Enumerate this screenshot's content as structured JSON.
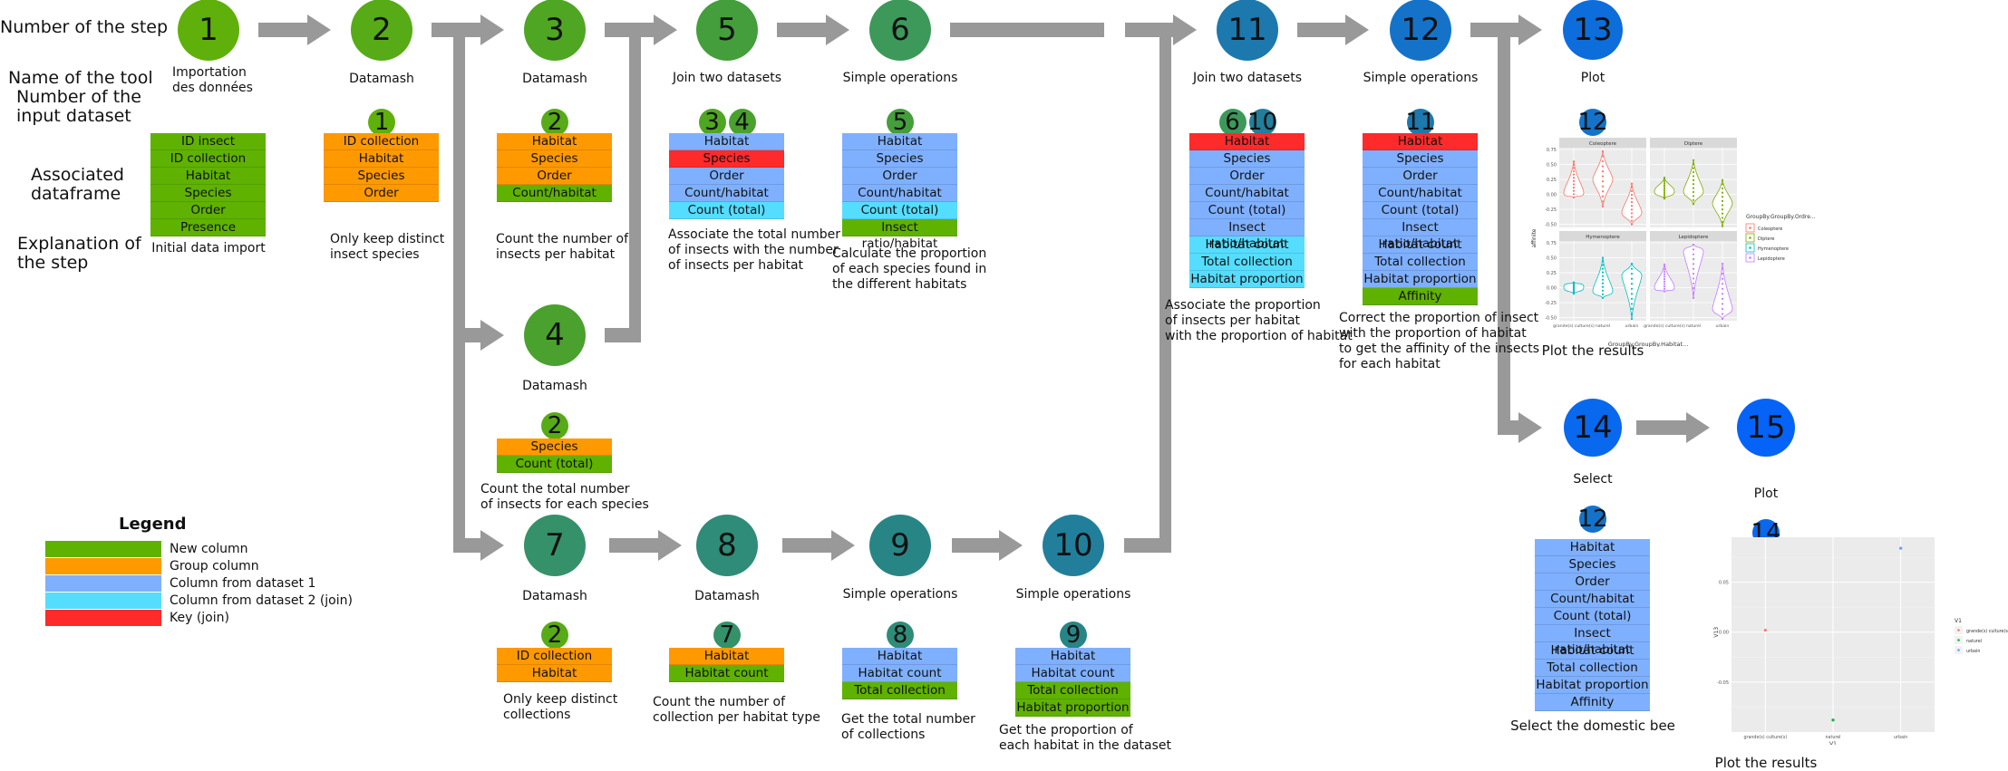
{
  "row_labels": {
    "step_number": "Number of the step",
    "tool_name": "Name of the tool",
    "input_dataset": "Number of the\ninput dataset",
    "dataframe": "Associated\ndataframe",
    "explanation": "Explanation of\nthe step"
  },
  "colors": {
    "new_column": "#5fb200",
    "group_column": "#ff9900",
    "dataset1": "#7fb0ff",
    "dataset2": "#55ddff",
    "key": "#ff2a2a",
    "arrow": "#999999"
  },
  "legend": {
    "title": "Legend",
    "items": [
      {
        "label": "New column",
        "type": "new_column"
      },
      {
        "label": "Group column",
        "type": "group_column"
      },
      {
        "label": "Column from dataset 1",
        "type": "dataset1"
      },
      {
        "label": "Column from dataset 2 (join)",
        "type": "dataset2"
      },
      {
        "label": "Key (join)",
        "type": "key"
      }
    ]
  },
  "steps": [
    {
      "id": "1",
      "color": "#5fb00a",
      "tool": "Importation\ndes données",
      "inputs": [],
      "columns": [
        [
          "ID insect",
          "new_column"
        ],
        [
          "ID collection",
          "new_column"
        ],
        [
          "Habitat",
          "new_column"
        ],
        [
          "Species",
          "new_column"
        ],
        [
          "Order",
          "new_column"
        ],
        [
          "Presence",
          "new_column"
        ]
      ],
      "explanation": "Initial data import"
    },
    {
      "id": "2",
      "color": "#57ab16",
      "tool": "Datamash",
      "inputs": [
        {
          "id": "1",
          "color": "#5fb00a"
        }
      ],
      "columns": [
        [
          "ID collection",
          "group_column"
        ],
        [
          "Habitat",
          "group_column"
        ],
        [
          "Species",
          "group_column"
        ],
        [
          "Order",
          "group_column"
        ]
      ],
      "explanation": "Only keep distinct\ninsect species"
    },
    {
      "id": "3",
      "color": "#4fa623",
      "tool": "Datamash",
      "inputs": [
        {
          "id": "2",
          "color": "#57ab16"
        }
      ],
      "columns": [
        [
          "Habitat",
          "group_column"
        ],
        [
          "Species",
          "group_column"
        ],
        [
          "Order",
          "group_column"
        ],
        [
          "Count/habitat",
          "new_column"
        ]
      ],
      "explanation": "Count the number of\ninsects per habitat"
    },
    {
      "id": "4",
      "color": "#4aa12e",
      "tool": "Datamash",
      "inputs": [
        {
          "id": "2",
          "color": "#57ab16"
        }
      ],
      "columns": [
        [
          "Species",
          "group_column"
        ],
        [
          "Count (total)",
          "new_column"
        ]
      ],
      "explanation": "Count the total number\nof insects for each species"
    },
    {
      "id": "5",
      "color": "#449e3b",
      "tool": "Join two datasets",
      "inputs": [
        {
          "id": "3",
          "color": "#4fa623"
        },
        {
          "id": "4",
          "color": "#4aa12e"
        }
      ],
      "columns": [
        [
          "Habitat",
          "dataset1"
        ],
        [
          "Species",
          "key"
        ],
        [
          "Order",
          "dataset1"
        ],
        [
          "Count/habitat",
          "dataset1"
        ],
        [
          "Count (total)",
          "dataset2"
        ]
      ],
      "explanation": "Associate the total number\nof insects with the number\nof insects per habitat"
    },
    {
      "id": "6",
      "color": "#3c995a",
      "tool": "Simple operations",
      "inputs": [
        {
          "id": "5",
          "color": "#449e3b"
        }
      ],
      "columns": [
        [
          "Habitat",
          "dataset1"
        ],
        [
          "Species",
          "dataset1"
        ],
        [
          "Order",
          "dataset1"
        ],
        [
          "Count/habitat",
          "dataset1"
        ],
        [
          "Count (total)",
          "dataset2"
        ],
        [
          "Insect ratio/habitat",
          "new_column"
        ]
      ],
      "explanation": "Calculate the proportion\nof each species found in\nthe different habitats"
    },
    {
      "id": "7",
      "color": "#349169",
      "tool": "Datamash",
      "inputs": [
        {
          "id": "2",
          "color": "#57ab16"
        }
      ],
      "columns": [
        [
          "ID collection",
          "group_column"
        ],
        [
          "Habitat",
          "group_column"
        ]
      ],
      "explanation": "Only keep distinct\ncollections"
    },
    {
      "id": "8",
      "color": "#2e8c78",
      "tool": "Datamash",
      "inputs": [
        {
          "id": "7",
          "color": "#349169"
        }
      ],
      "columns": [
        [
          "Habitat",
          "group_column"
        ],
        [
          "Habitat count",
          "new_column"
        ]
      ],
      "explanation": "Count the number of\ncollection per habitat type"
    },
    {
      "id": "9",
      "color": "#288586",
      "tool": "Simple operations",
      "inputs": [
        {
          "id": "8",
          "color": "#2e8c78"
        }
      ],
      "columns": [
        [
          "Habitat",
          "dataset1"
        ],
        [
          "Habitat count",
          "dataset1"
        ],
        [
          "Total collection",
          "new_column"
        ]
      ],
      "explanation": "Get the total number\nof collections"
    },
    {
      "id": "10",
      "color": "#217f9c",
      "tool": "Simple operations",
      "inputs": [
        {
          "id": "9",
          "color": "#288586"
        }
      ],
      "columns": [
        [
          "Habitat",
          "dataset1"
        ],
        [
          "Habitat count",
          "dataset1"
        ],
        [
          "Total collection",
          "new_column"
        ],
        [
          "Habitat proportion",
          "new_column"
        ]
      ],
      "explanation": "Get the proportion of\neach habitat in the dataset"
    },
    {
      "id": "11",
      "color": "#1c78ad",
      "tool": "Join two datasets",
      "inputs": [
        {
          "id": "6",
          "color": "#3c995a"
        },
        {
          "id": "10",
          "color": "#217f9c"
        }
      ],
      "columns": [
        [
          "Habitat",
          "key"
        ],
        [
          "Species",
          "dataset1"
        ],
        [
          "Order",
          "dataset1"
        ],
        [
          "Count/habitat",
          "dataset1"
        ],
        [
          "Count (total)",
          "dataset1"
        ],
        [
          "Insect ratio/habitat",
          "dataset1"
        ],
        [
          "Habitat count",
          "dataset2"
        ],
        [
          "Total collection",
          "dataset2"
        ],
        [
          "Habitat proportion",
          "dataset2"
        ]
      ],
      "explanation": "Associate the proportion\nof insects per habitat\nwith the proportion of habitat"
    },
    {
      "id": "12",
      "color": "#1473c9",
      "tool": "Simple operations",
      "inputs": [
        {
          "id": "11",
          "color": "#1c78ad"
        }
      ],
      "columns": [
        [
          "Habitat",
          "key"
        ],
        [
          "Species",
          "dataset1"
        ],
        [
          "Order",
          "dataset1"
        ],
        [
          "Count/habitat",
          "dataset1"
        ],
        [
          "Count (total)",
          "dataset1"
        ],
        [
          "Insect ratio/habitat",
          "dataset1"
        ],
        [
          "Habitat count",
          "dataset1"
        ],
        [
          "Total collection",
          "dataset1"
        ],
        [
          "Habitat proportion",
          "dataset1"
        ],
        [
          "Affinity",
          "new_column"
        ]
      ],
      "explanation": "Correct the proportion of insect\nwith the proportion of habitat\nto get the affinity of the insects\nfor each habitat"
    },
    {
      "id": "13",
      "color": "#0d6ddb",
      "tool": "Plot",
      "inputs": [
        {
          "id": "12",
          "color": "#1473c9"
        }
      ],
      "columns": [],
      "explanation": "Plot the results"
    },
    {
      "id": "14",
      "color": "#0868ee",
      "tool": "Select",
      "inputs": [
        {
          "id": "12",
          "color": "#1473c9"
        }
      ],
      "columns": [
        [
          "Habitat",
          "dataset1"
        ],
        [
          "Species",
          "dataset1"
        ],
        [
          "Order",
          "dataset1"
        ],
        [
          "Count/habitat",
          "dataset1"
        ],
        [
          "Count (total)",
          "dataset1"
        ],
        [
          "Insect ratio/habitat",
          "dataset1"
        ],
        [
          "Habitat count",
          "dataset1"
        ],
        [
          "Total collection",
          "dataset1"
        ],
        [
          "Habitat proportion",
          "dataset1"
        ],
        [
          "Affinity",
          "dataset1"
        ]
      ],
      "explanation": "Select the domestic bee"
    },
    {
      "id": "15",
      "color": "#0563f8",
      "tool": "Plot",
      "inputs": [
        {
          "id": "14",
          "color": "#0868ee"
        }
      ],
      "columns": [],
      "explanation": "Plot the results"
    }
  ],
  "chart_data": [
    {
      "type": "violin",
      "title": "",
      "xlabel": "GroupBy.GroupBy.Habitat...",
      "ylabel": "affinite",
      "ylim": [
        -0.55,
        0.78
      ],
      "yticks": [
        "-0.50",
        "-0.25",
        "0.00",
        "0.25",
        "0.50",
        "0.75"
      ],
      "ytick_values": [
        -0.5,
        -0.25,
        0,
        0.25,
        0.5,
        0.75
      ],
      "categories": [
        "grande(s) culture(s)",
        "naturel",
        "urbain"
      ],
      "legend_title": "GroupBy.GroupBy.Ordre...",
      "legend_position": "right",
      "panels": [
        {
          "name": "Coleoptere",
          "color": "#f8766d",
          "ranges": [
            [
              -0.05,
              0.55,
              0.03
            ],
            [
              -0.2,
              0.72,
              0.25
            ],
            [
              -0.5,
              0.18,
              -0.3
            ]
          ]
        },
        {
          "name": "Diptere",
          "color": "#7cae00",
          "ranges": [
            [
              -0.07,
              0.28,
              0.05
            ],
            [
              -0.16,
              0.57,
              0.05
            ],
            [
              -0.53,
              0.24,
              -0.15
            ]
          ]
        },
        {
          "name": "Hymenoptere",
          "color": "#00bfc4",
          "ranges": [
            [
              -0.1,
              0.09,
              0.01
            ],
            [
              -0.17,
              0.5,
              -0.05
            ],
            [
              -0.52,
              0.4,
              0.2
            ]
          ]
        },
        {
          "name": "Lepidoptere",
          "color": "#c77cff",
          "ranges": [
            [
              -0.06,
              0.39,
              0.01
            ],
            [
              -0.17,
              0.72,
              0.6
            ],
            [
              -0.52,
              0.4,
              -0.35
            ]
          ]
        }
      ]
    },
    {
      "type": "scatter",
      "title": "",
      "xlabel": "V1",
      "ylabel": "V13",
      "ylim": [
        -0.1,
        0.095
      ],
      "yticks": [
        "-0.05",
        "0.00",
        "0.05"
      ],
      "ytick_values": [
        -0.05,
        0,
        0.05
      ],
      "categories": [
        "grande(s) culture(s)",
        "naturel",
        "urbain"
      ],
      "legend_title": "V1",
      "legend_position": "right",
      "points": [
        {
          "x": "grande(s) culture(s)",
          "y": 0.002,
          "color": "#f8766d"
        },
        {
          "x": "naturel",
          "y": -0.088,
          "color": "#00ba38"
        },
        {
          "x": "urbain",
          "y": 0.084,
          "color": "#619cff"
        }
      ]
    }
  ]
}
